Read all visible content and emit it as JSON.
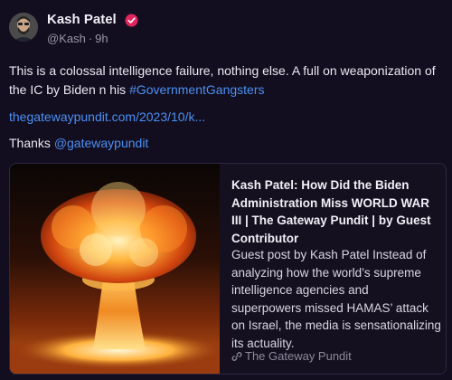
{
  "post": {
    "author": {
      "name": "Kash Patel",
      "handle": "@Kash",
      "time": "9h",
      "separator": "·",
      "avatar_icon": "person-photo-avatar",
      "verified_icon": "verified-badge-icon"
    },
    "text": {
      "line1_prefix": "This is a colossal intelligence failure, nothing else. A full on weaponization of the IC by Biden n his ",
      "hashtag": "#GovernmentGangsters",
      "url": "thegatewaypundit.com/2023/10/k...",
      "thanks_prefix": "Thanks ",
      "mention": "@gatewaypundit"
    },
    "link_card": {
      "image_icon": "mushroom-cloud-explosion-image",
      "title": "Kash Patel: How Did the Biden Administration Miss WORLD WAR III | The Gateway Pundit | by Guest Contributor",
      "description": "Guest post by Kash Patel Instead of analyzing how the world’s supreme intelligence agencies and superpowers missed HAMAS’ attack on Israel, the media is sensationalizing its actuality.",
      "source_icon": "link-chain-icon",
      "source": "The Gateway Pundit"
    }
  },
  "colors": {
    "background": "#120e1f",
    "link": "#4c8ff4",
    "verified": "#e0245e",
    "muted": "#9a95a8"
  }
}
